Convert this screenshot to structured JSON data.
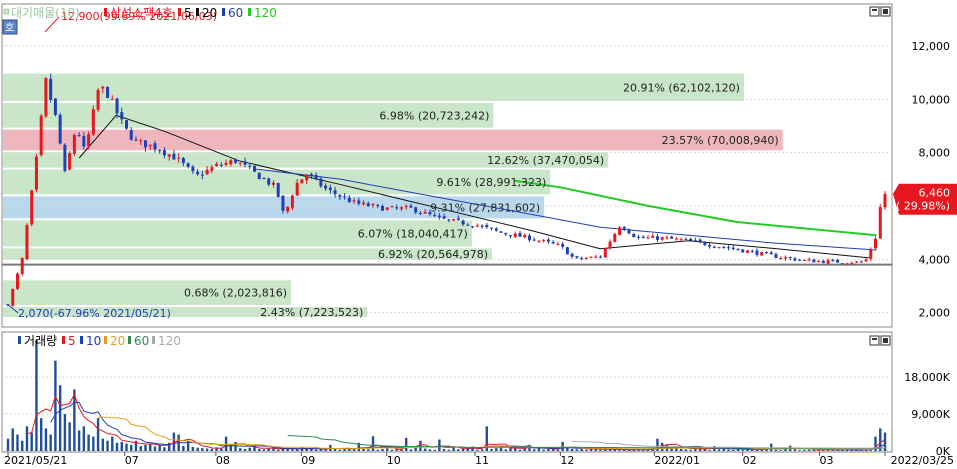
{
  "colors": {
    "up": "#e8171d",
    "down": "#1f3fb8",
    "ma5": "#e8171d",
    "ma20": "#111111",
    "ma60": "#1f3fb8",
    "ma120": "#22cc22",
    "band_green": "#c9e6c9",
    "band_pink": "#efb7bd",
    "band_blue": "#b9d8ec",
    "vol_bar": "#1f4f99",
    "vol5": "#e8171d",
    "vol10": "#1f3fb8",
    "vol20": "#e39d1a",
    "vol60": "#2e8b57",
    "vol120": "#aaaaaa",
    "price_tag": "#e8171d"
  },
  "legend": {
    "label_index": "대기매물(10)",
    "label_name": "삼성스팩4호",
    "ma": [
      "5",
      "20",
      "60",
      "120"
    ]
  },
  "volume_legend": {
    "label": "거래량",
    "ma": [
      "5",
      "10",
      "20",
      "60",
      "120"
    ]
  },
  "side_button": "호",
  "chart_data": [
    {
      "type": "candlestick",
      "name": "삼성스팩4호",
      "y_axis": {
        "range": [
          1500,
          13500
        ],
        "ticks": [
          "12,000",
          "10,000",
          "8,000",
          "6,000",
          "4,000",
          "2,000"
        ],
        "tick_values": [
          12000,
          10000,
          8000,
          6000,
          4000,
          2000
        ]
      },
      "x_axis": {
        "labels": [
          "2021/05/21",
          "07",
          "08",
          "09",
          "10",
          "11",
          "12",
          "2022/01",
          "02",
          "03",
          "2022/03/25"
        ],
        "label_dates": [
          "2021-05-21",
          "2021-07-01",
          "2021-08-02",
          "2021-09-01",
          "2021-10-01",
          "2021-11-01",
          "2021-12-01",
          "2022-01-03",
          "2022-02-03",
          "2022-03-02",
          "2022-03-25"
        ],
        "range": [
          "2021-05-21",
          "2022-03-25"
        ]
      },
      "annotations": {
        "high": {
          "text": "12,900(99.69% 2021/06/03)",
          "value": 12900,
          "date": "2021-06-03"
        },
        "low": {
          "text": "2,070(-67.96% 2021/05/21)",
          "value": 2070,
          "date": "2021-05-21"
        },
        "last_price": "6,460",
        "last_change": "( 29.98%)",
        "last_value": 6460,
        "reference_line": 3800
      },
      "supply_zones": [
        {
          "lo": 1800,
          "hi": 2250,
          "label": "2.43% (7,223,523)",
          "color": "band_green"
        },
        {
          "lo": 2250,
          "hi": 3250,
          "label": "0.68% (2,023,816)",
          "color": "band_green"
        },
        {
          "lo": 3950,
          "hi": 4450,
          "label": "6.92% (20,564,978)",
          "color": "band_green"
        },
        {
          "lo": 4450,
          "hi": 5500,
          "label": "6.07% (18,040,417)",
          "color": "band_green"
        },
        {
          "lo": 5500,
          "hi": 6400,
          "label": "9.31% (27,831,602)",
          "color": "band_blue"
        },
        {
          "lo": 6400,
          "hi": 7400,
          "label": "9.61% (28,991,323)",
          "color": "band_green"
        },
        {
          "lo": 7400,
          "hi": 8050,
          "label": "12.62% (37,470,054)",
          "color": "band_green"
        },
        {
          "lo": 8050,
          "hi": 8900,
          "label": "23.57% (70,008,940)",
          "color": "band_pink"
        },
        {
          "lo": 8900,
          "hi": 9900,
          "label": "6.98% (20,723,242)",
          "color": "band_green"
        },
        {
          "lo": 9900,
          "hi": 11000,
          "label": "20.91% (62,102,120)",
          "color": "band_green"
        }
      ],
      "price_path": [
        [
          "2021-05-21",
          2300
        ],
        [
          "2021-05-26",
          4000
        ],
        [
          "2021-06-01",
          8500
        ],
        [
          "2021-06-03",
          10800
        ],
        [
          "2021-06-07",
          9200
        ],
        [
          "2021-06-10",
          7200
        ],
        [
          "2021-06-14",
          9000
        ],
        [
          "2021-06-17",
          8000
        ],
        [
          "2021-06-22",
          10500
        ],
        [
          "2021-06-25",
          10200
        ],
        [
          "2021-07-01",
          8900
        ],
        [
          "2021-07-05",
          8400
        ],
        [
          "2021-07-12",
          8200
        ],
        [
          "2021-07-19",
          7800
        ],
        [
          "2021-07-26",
          7100
        ],
        [
          "2021-08-02",
          7500
        ],
        [
          "2021-08-09",
          7700
        ],
        [
          "2021-08-16",
          7200
        ],
        [
          "2021-08-23",
          6700
        ],
        [
          "2021-08-26",
          5600
        ],
        [
          "2021-08-30",
          6800
        ],
        [
          "2021-09-03",
          7200
        ],
        [
          "2021-09-10",
          6600
        ],
        [
          "2021-09-20",
          6100
        ],
        [
          "2021-10-01",
          5900
        ],
        [
          "2021-10-10",
          5900
        ],
        [
          "2021-10-20",
          5500
        ],
        [
          "2021-11-01",
          5300
        ],
        [
          "2021-11-10",
          5000
        ],
        [
          "2021-11-20",
          4800
        ],
        [
          "2021-12-01",
          4500
        ],
        [
          "2021-12-06",
          4000
        ],
        [
          "2021-12-15",
          4100
        ],
        [
          "2021-12-22",
          5300
        ],
        [
          "2021-12-28",
          4800
        ],
        [
          "2022-01-05",
          4800
        ],
        [
          "2022-01-15",
          4700
        ],
        [
          "2022-01-25",
          4500
        ],
        [
          "2022-02-05",
          4300
        ],
        [
          "2022-02-15",
          4100
        ],
        [
          "2022-02-25",
          3950
        ],
        [
          "2022-03-10",
          3900
        ],
        [
          "2022-03-18",
          3900
        ],
        [
          "2022-03-22",
          4900
        ],
        [
          "2022-03-24",
          6460
        ]
      ],
      "ma_paths": {
        "ma20": [
          [
            "2021-06-15",
            7800
          ],
          [
            "2021-06-28",
            9400
          ],
          [
            "2021-07-15",
            8800
          ],
          [
            "2021-08-10",
            7700
          ],
          [
            "2021-09-15",
            6800
          ],
          [
            "2021-10-20",
            5900
          ],
          [
            "2021-11-20",
            5100
          ],
          [
            "2021-12-15",
            4400
          ],
          [
            "2022-01-15",
            4700
          ],
          [
            "2022-02-15",
            4400
          ],
          [
            "2022-03-20",
            4050
          ]
        ],
        "ma60": [
          [
            "2021-08-15",
            7400
          ],
          [
            "2021-09-15",
            7000
          ],
          [
            "2021-10-15",
            6400
          ],
          [
            "2021-11-15",
            5800
          ],
          [
            "2021-12-15",
            5200
          ],
          [
            "2022-01-15",
            4900
          ],
          [
            "2022-02-15",
            4600
          ],
          [
            "2022-03-22",
            4350
          ]
        ],
        "ma120": [
          [
            "2021-11-15",
            6950
          ],
          [
            "2021-12-01",
            6700
          ],
          [
            "2022-01-01",
            6000
          ],
          [
            "2022-02-01",
            5400
          ],
          [
            "2022-03-22",
            4900
          ]
        ]
      }
    },
    {
      "type": "bar",
      "name": "거래량",
      "y_axis": {
        "range": [
          0,
          28000
        ],
        "ticks": [
          "18,000K",
          "9,000K",
          "0K"
        ],
        "tick_values": [
          18000,
          9000,
          0
        ]
      },
      "series": [
        {
          "name": "거래량",
          "values": [
            3000,
            5500,
            4000,
            2500,
            6000,
            4500,
            27000,
            8000,
            5500,
            4000,
            22000,
            16000,
            9000,
            7000,
            15000,
            5000,
            6000,
            4000,
            3500,
            8000,
            3000,
            2500,
            3500,
            2000,
            2200,
            1800,
            1500,
            2500,
            1200,
            1500,
            1800,
            1100,
            1500,
            900,
            2000,
            4500,
            4000,
            1200,
            2500,
            1000,
            800,
            700,
            600,
            500,
            900,
            700,
            3500,
            1500,
            2200,
            700,
            500,
            800,
            1200,
            500,
            400,
            600,
            800,
            300,
            500,
            700,
            400,
            500,
            900,
            600,
            500,
            300,
            450,
            350,
            1500,
            500,
            300,
            500,
            600,
            400,
            2000,
            500,
            400,
            3600,
            300,
            500,
            600,
            300,
            400,
            350,
            3200,
            400,
            1000,
            2500,
            600,
            400,
            300,
            2800,
            500,
            300,
            900,
            400,
            700,
            500,
            1100,
            300,
            400,
            6000,
            500,
            700,
            800,
            400,
            1200,
            600,
            300,
            800,
            1500,
            400,
            600,
            350,
            500,
            600,
            300,
            2200,
            700,
            500,
            400,
            800,
            300,
            500,
            400,
            300,
            600,
            350,
            300,
            200,
            300,
            250,
            400,
            300,
            200,
            500,
            700,
            3000,
            2000,
            1500,
            800,
            1000,
            500,
            400,
            300,
            900,
            500,
            700,
            200,
            1200,
            400,
            800,
            350,
            300,
            500,
            200,
            600,
            300,
            300,
            400,
            400,
            1800,
            300,
            200,
            500,
            1300,
            600,
            200,
            250,
            300,
            300,
            200,
            200,
            700,
            200,
            200,
            300,
            400,
            200,
            250,
            300,
            450,
            200,
            3500,
            5500,
            4500
          ]
        }
      ]
    }
  ]
}
